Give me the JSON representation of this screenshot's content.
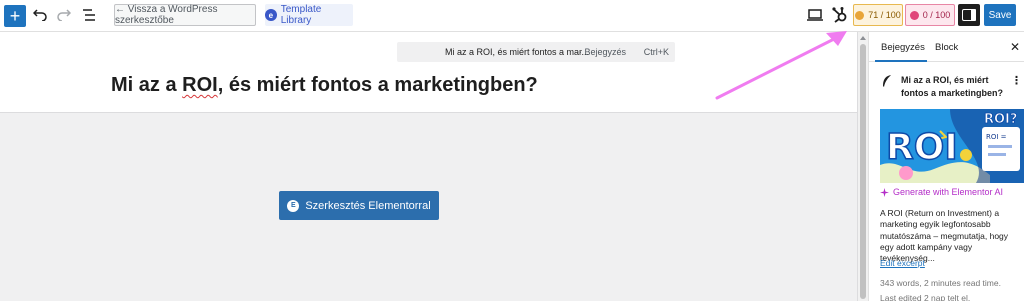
{
  "toolbar": {
    "add_label": "+",
    "back_label": "← Vissza a WordPress szerkesztőbe",
    "template_library_label": "Template Library",
    "template_logo": "e",
    "seo_score": "71 / 100",
    "readability_score": "0 / 100",
    "save_label": "Save"
  },
  "command_bar": {
    "title": "Mi az a ROI, és miért fontos a mar...",
    "type": "· Bejegyzés",
    "shortcut": "Ctrl+K"
  },
  "post": {
    "title_part1": "Mi az a ",
    "title_roi": "ROI",
    "title_part2": ", és miért fontos a marketingben?"
  },
  "elementor": {
    "button_label": "Szerkesztés Elementorral",
    "logo": "E"
  },
  "sidebar": {
    "tab_post": "Bejegyzés",
    "tab_block": "Block",
    "close": "✕",
    "post_title": "Mi az a ROI, és miért fontos a marketingben?",
    "more": "⋮",
    "image_text_roi": "ROI",
    "image_text_roi_q": "ROI?",
    "image_small": "ROI =",
    "generate_ai": "Generate with Elementor AI",
    "excerpt": "A ROI (Return on Investment) a marketing egyik legfontosabb mutatószáma – megmutatja, hogy egy adott kampány vagy tevékenység...",
    "edit_excerpt": "Edit excerpt",
    "meta_words": "343 words, 2 minutes read time.",
    "meta_edited": "Last edited 2 nap telt el."
  },
  "colors": {
    "accent": "#1e73be",
    "elementor_button": "#2c6ead",
    "seo_bg": "#fdf3de",
    "readability_bg": "#fde7ee",
    "ai_link": "#b42ec8",
    "annotation_arrow": "#f07cf0"
  }
}
